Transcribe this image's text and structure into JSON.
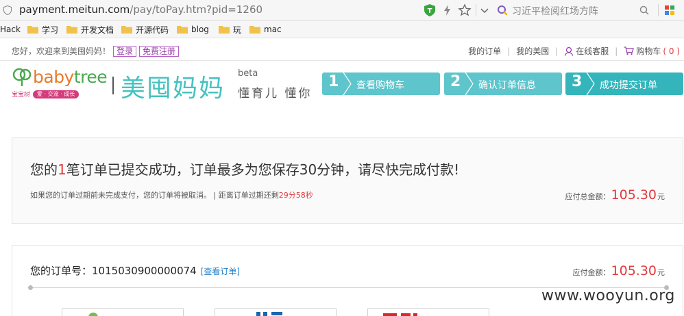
{
  "browser": {
    "url_main": "payment.meitun.com",
    "url_path": "/pay/toPay.htm?pid=1260",
    "search_placeholder": "习近平检阅红场方阵"
  },
  "bookmarks": [
    {
      "label": "Hack"
    },
    {
      "label": "学习"
    },
    {
      "label": "开发文档"
    },
    {
      "label": "开源代码"
    },
    {
      "label": "blog"
    },
    {
      "label": "玩"
    },
    {
      "label": "mac"
    }
  ],
  "topbar": {
    "welcome": "您好，欢迎来到美囤妈妈！",
    "login": "登录",
    "register": "免费注册",
    "my_orders": "我的订单",
    "my_meitun": "我的美囤",
    "online_service": "在线客服",
    "cart": "购物车",
    "cart_count": "( 0 )",
    "separator": "|"
  },
  "header": {
    "logo_baby": "baby",
    "logo_tree": "tree",
    "logo_cn": "宝宝树",
    "logo_tagline": "爱 · 交流 · 成长",
    "brand": "美囤妈妈",
    "beta": "beta",
    "slogan": "懂育儿 懂你"
  },
  "steps": [
    {
      "num": "1",
      "label": "查看购物车"
    },
    {
      "num": "2",
      "label": "确认订单信息"
    },
    {
      "num": "3",
      "label": "成功提交订单"
    }
  ],
  "success": {
    "title_prefix": "您的",
    "title_count": "1",
    "title_suffix": "笔订单已提交成功，订单最多为您保存30分钟，请尽快完成付款!",
    "note": "如果您的订单过期前未完成支付，您的订单将被取消。 | 距离订单过期还剩",
    "countdown": "29分58秒",
    "amount_label": "应付总金额：",
    "amount": "105.30",
    "currency": "元"
  },
  "order": {
    "label": "您的订单号：",
    "number": "1015030900000074",
    "view_link": "[查看订单]",
    "amount_label": "应付金额：",
    "amount": "105.30",
    "currency": "元"
  },
  "watermark": "www.wooyun.org",
  "colors": {
    "accent": "#45c2c0",
    "step": "#5ec5cc",
    "price_red": "#e4393c",
    "login_purple": "#9b3fae"
  }
}
